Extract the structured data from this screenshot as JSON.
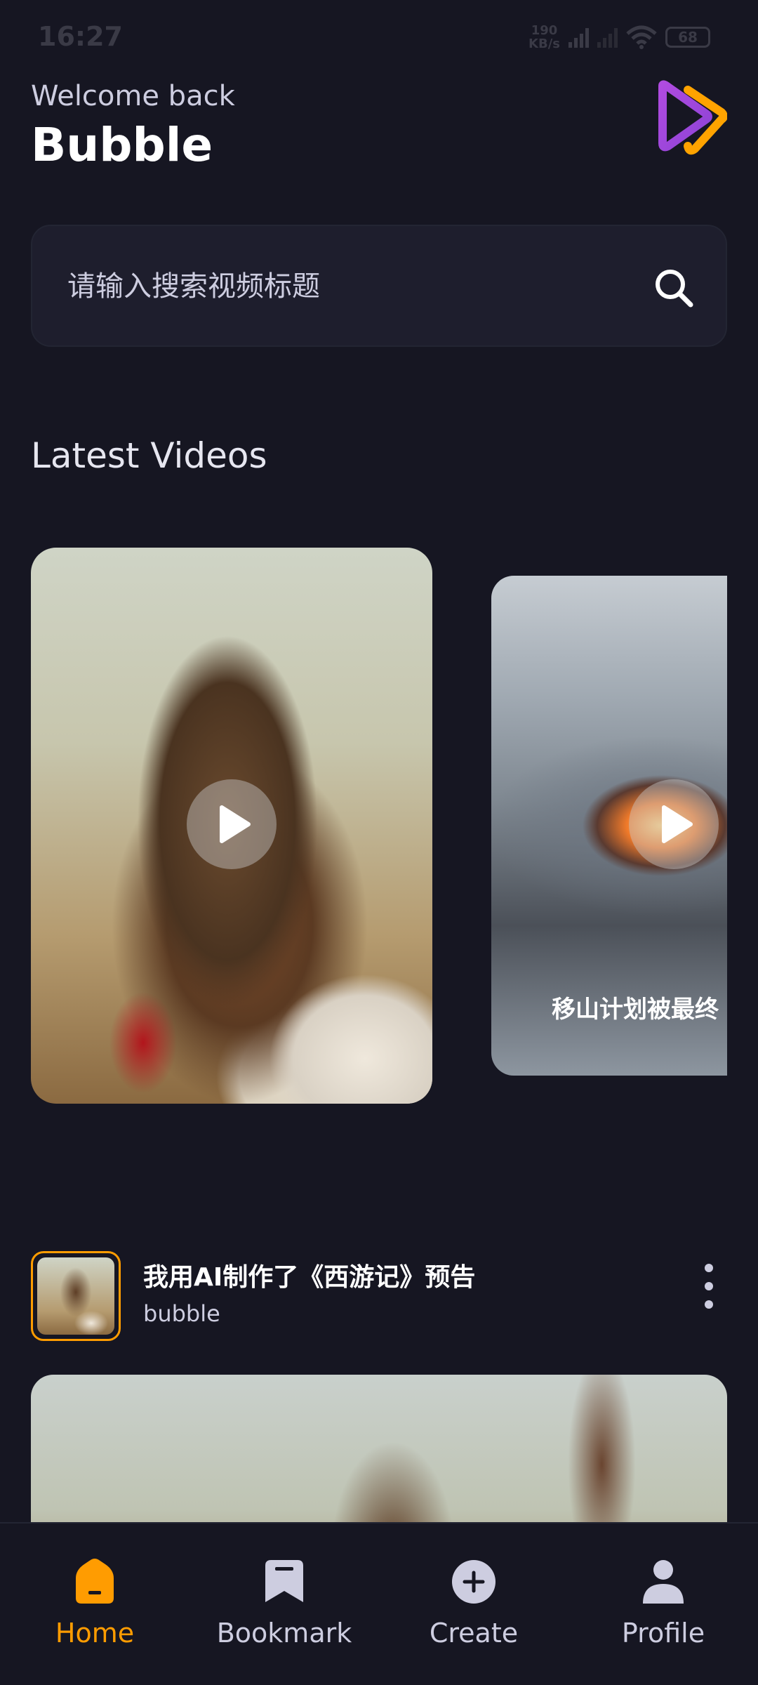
{
  "status_bar": {
    "time": "16:27",
    "net_speed_value": "190",
    "net_speed_unit": "KB/s",
    "battery": "68"
  },
  "header": {
    "welcome": "Welcome back",
    "username": "Bubble",
    "logo_icon": "bubble-logo-icon"
  },
  "search": {
    "placeholder": "请输入搜索视频标题",
    "icon": "search-icon"
  },
  "latest": {
    "title": "Latest Videos",
    "cards": [
      {
        "caption": ""
      },
      {
        "caption": "移山计划被最终"
      }
    ]
  },
  "post": {
    "title": "我用AI制作了《西游记》预告",
    "author": "bubble"
  },
  "nav": {
    "items": [
      {
        "label": "Home",
        "icon": "home-icon",
        "active": true
      },
      {
        "label": "Bookmark",
        "icon": "bookmark-icon",
        "active": false
      },
      {
        "label": "Create",
        "icon": "plus-icon",
        "active": false
      },
      {
        "label": "Profile",
        "icon": "profile-icon",
        "active": false
      }
    ]
  },
  "colors": {
    "background": "#161622",
    "accent": "#FF9C01",
    "card": "#1E1E2D",
    "muted_text": "#CDCDE0"
  }
}
